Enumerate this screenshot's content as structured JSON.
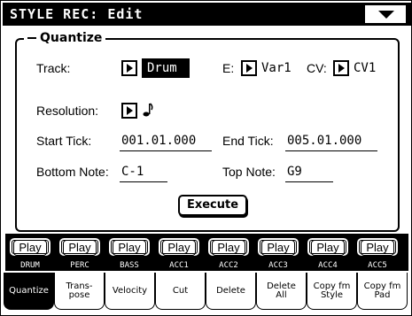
{
  "title": "STYLE REC: Edit",
  "menu_icon": "chevron-down-icon",
  "group": {
    "title": "Quantize",
    "track_label": "Track:",
    "track_value": "Drum",
    "e_label": "E:",
    "e_value": "Var1",
    "cv_label": "CV:",
    "cv_value": "CV1",
    "resolution_label": "Resolution:",
    "resolution_icon": "eighth-note-icon",
    "start_tick_label": "Start Tick:",
    "start_tick_value": "001.01.000",
    "end_tick_label": "End Tick:",
    "end_tick_value": "005.01.000",
    "bottom_note_label": "Bottom Note:",
    "bottom_note_value": "C-1",
    "top_note_label": "Top Note:",
    "top_note_value": "G9",
    "execute_label": "Execute"
  },
  "play_buttons": [
    "Play",
    "Play",
    "Play",
    "Play",
    "Play",
    "Play",
    "Play",
    "Play"
  ],
  "channels": [
    "DRUM",
    "PERC",
    "BASS",
    "ACC1",
    "ACC2",
    "ACC3",
    "ACC4",
    "ACC5"
  ],
  "tabs": [
    "Quantize",
    "Trans-\npose",
    "Velocity",
    "Cut",
    "Delete",
    "Delete\nAll",
    "Copy fm\nStyle",
    "Copy fm\nPad"
  ],
  "active_tab": "Quantize"
}
